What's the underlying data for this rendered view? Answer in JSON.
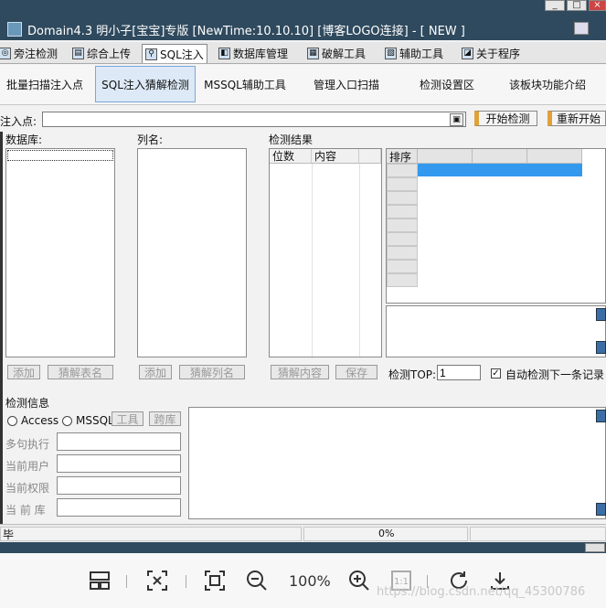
{
  "window": {
    "title": "Domain4.3 明小子[宝宝]专版 [NewTime:10.10.10] [博客LOGO连接]  - [ NEW ]",
    "min": "_",
    "max": "□",
    "close": "×"
  },
  "top_tabs": [
    {
      "label": "旁注检测",
      "icon": "target-icon"
    },
    {
      "label": "综合上传",
      "icon": "upload-icon"
    },
    {
      "label": "SQL注入",
      "icon": "magnifier-icon",
      "active": true
    },
    {
      "label": "数据库管理",
      "icon": "database-icon"
    },
    {
      "label": "破解工具",
      "icon": "keyboard-icon"
    },
    {
      "label": "辅助工具",
      "icon": "clipboard-icon"
    },
    {
      "label": "关于程序",
      "icon": "book-icon"
    }
  ],
  "sub_tabs": [
    "批量扫描注入点",
    "SQL注入猜解检测",
    "MSSQL辅助工具",
    "管理入口扫描",
    "检测设置区",
    "该板块功能介绍"
  ],
  "inject": {
    "label": "注入点:",
    "value": "",
    "start": "开始检测",
    "restart": "重新开始"
  },
  "db": {
    "label": "数据库:",
    "add": "添加",
    "guess": "猜解表名"
  },
  "cols": {
    "label": "列名:",
    "add": "添加",
    "guess": "猜解列名"
  },
  "result": {
    "label": "检测结果",
    "col1": "位数",
    "col2": "内容",
    "guess": "猜解内容",
    "save": "保存"
  },
  "grid": {
    "header": "排序"
  },
  "top": {
    "label": "检测TOP:",
    "value": "1",
    "auto": "自动检测下一条记录"
  },
  "info": {
    "label": "检测信息",
    "access": "Access",
    "mssql": "MSSQL",
    "tool": "工具",
    "cross": "跨库",
    "multi": "多句执行",
    "user": "当前用户",
    "perm": "当前权限",
    "dbname": "当 前 库"
  },
  "status": {
    "left": "毕",
    "progress": "0%"
  },
  "viewer": {
    "zoom": "100%",
    "watermark": "https://blog.csdn.net/qq_45300786"
  }
}
